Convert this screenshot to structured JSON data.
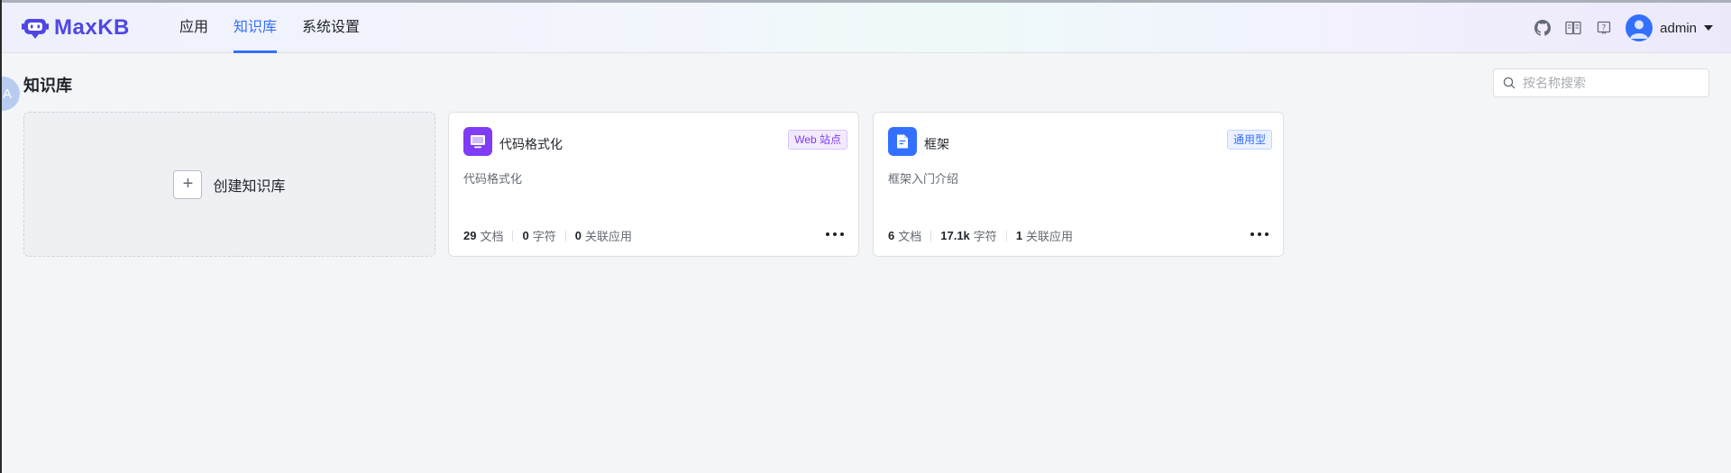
{
  "app": {
    "logo_text": "MaxKB"
  },
  "nav": {
    "items": [
      {
        "label": "应用",
        "active": false
      },
      {
        "label": "知识库",
        "active": true
      },
      {
        "label": "系统设置",
        "active": false
      }
    ]
  },
  "header": {
    "icons": [
      "github-icon",
      "book-icon",
      "help-icon"
    ],
    "user": {
      "name": "admin"
    }
  },
  "side_bubble": {
    "text": "A"
  },
  "page": {
    "title": "知识库"
  },
  "search": {
    "placeholder": "按名称搜索",
    "value": ""
  },
  "create": {
    "label": "创建知识库"
  },
  "knowledge_bases": [
    {
      "name": "代码格式化",
      "tag": "Web 站点",
      "desc": "代码格式化",
      "icon": "web-site-icon",
      "icon_color": "#7f3bf5",
      "tag_color": "#7f3bf5",
      "stats": {
        "docs": "29",
        "docs_label": "文档",
        "chars": "0",
        "chars_label": "字符",
        "apps": "0",
        "apps_label": "关联应用"
      }
    },
    {
      "name": "框架",
      "tag": "通用型",
      "desc": "框架入门介绍",
      "icon": "document-icon",
      "icon_color": "#3370ff",
      "tag_color": "#3370ff",
      "stats": {
        "docs": "6",
        "docs_label": "文档",
        "chars": "17.1k",
        "chars_label": "字符",
        "apps": "1",
        "apps_label": "关联应用"
      }
    }
  ],
  "colors": {
    "primary": "#3370ff",
    "brand": "#4f46e5",
    "background": "#f4f5f7"
  }
}
